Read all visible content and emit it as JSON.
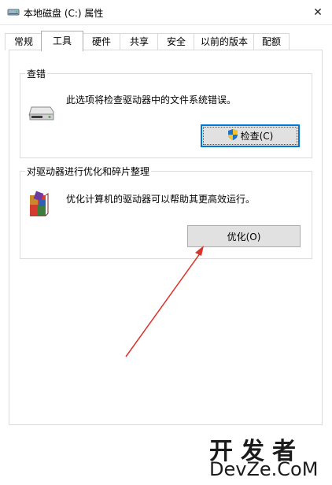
{
  "window": {
    "title": "本地磁盘 (C:) 属性",
    "icon": "drive-icon",
    "close_label": "✕"
  },
  "tabs": [
    {
      "label": "常规",
      "active": false
    },
    {
      "label": "工具",
      "active": true
    },
    {
      "label": "硬件",
      "active": false
    },
    {
      "label": "共享",
      "active": false
    },
    {
      "label": "安全",
      "active": false
    },
    {
      "label": "以前的版本",
      "active": false
    },
    {
      "label": "配额",
      "active": false
    }
  ],
  "check_group": {
    "title": "查错",
    "description": "此选项将检查驱动器中的文件系统错误。",
    "button_label": "检查(C)",
    "icon": "hard-drive-icon",
    "button_icon": "shield-icon"
  },
  "optimize_group": {
    "title": "对驱动器进行优化和碎片整理",
    "description": "优化计算机的驱动器可以帮助其更高效运行。",
    "button_label": "优化(O)",
    "icon": "defrag-icon"
  },
  "annotation": {
    "arrow_color": "#d9342b"
  },
  "watermark": {
    "line1": "开发者",
    "line2": "DevZe.CoM"
  },
  "colors": {
    "accent": "#0078d7",
    "button_face": "#e1e1e1"
  }
}
